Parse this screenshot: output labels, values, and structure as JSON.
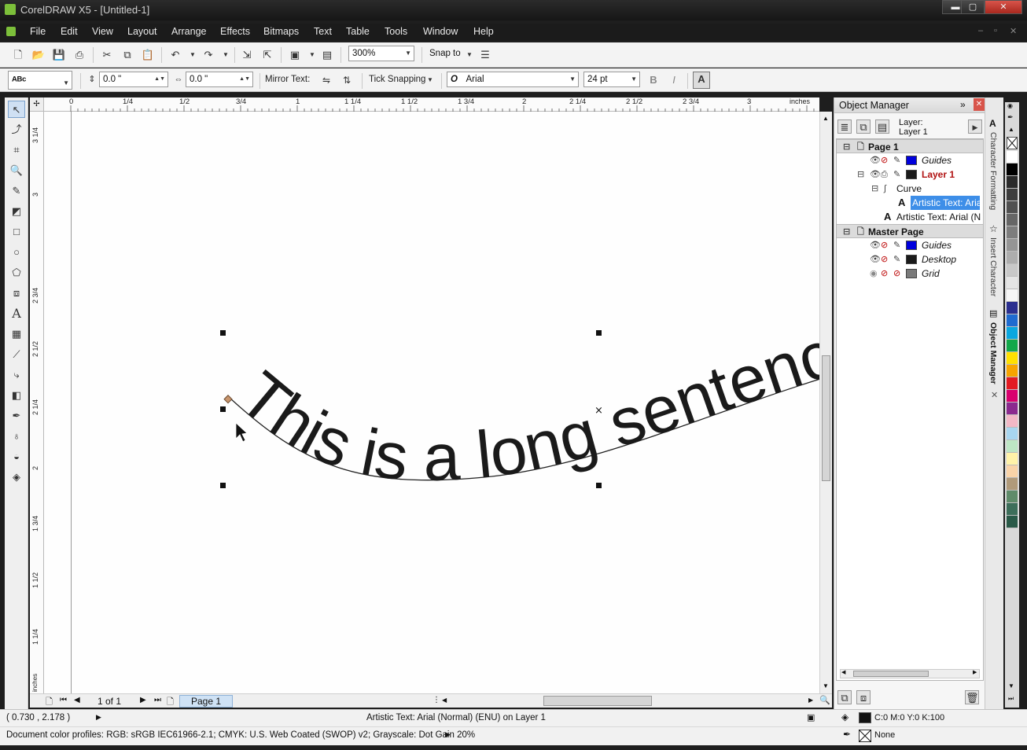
{
  "window": {
    "title": "CorelDRAW X5 - [Untitled-1]",
    "minimize": "▬",
    "maximize": "▢",
    "close": "✕"
  },
  "menu": {
    "items": [
      "File",
      "Edit",
      "View",
      "Layout",
      "Arrange",
      "Effects",
      "Bitmaps",
      "Text",
      "Table",
      "Tools",
      "Window",
      "Help"
    ],
    "mdi_controls": [
      "–",
      "▫",
      "✕"
    ]
  },
  "standard_toolbar": {
    "zoom": "300%",
    "snap_to": "Snap to"
  },
  "property_bar": {
    "preset_label": "ᴬᴮᶜ",
    "offset_x": "0.0 \"",
    "offset_y": "0.0 \"",
    "mirror_text": "Mirror Text:",
    "tick_snapping": "Tick Snapping",
    "font": "Arial",
    "font_glyph": "O",
    "size": "24 pt",
    "bold": "B",
    "italic": "I"
  },
  "ruler": {
    "units": "inches",
    "h_ticks": [
      "0",
      "1/4",
      "1/2",
      "3/4",
      "1",
      "1 1/4",
      "1 1/2",
      "1 3/4",
      "2",
      "2 1/4",
      "2 1/2",
      "2 3/4",
      "3"
    ],
    "v_ticks": [
      "3 1/4",
      "3",
      "2 3/4",
      "2 1/2",
      "2 1/4",
      "2",
      "1 3/4",
      "1 1/2",
      "1 1/4"
    ]
  },
  "canvas": {
    "artistic_text": "This is a long sentence that follows a curve"
  },
  "page_nav": {
    "count": "1 of 1",
    "tab": "Page 1"
  },
  "object_manager": {
    "title": "Object Manager",
    "layer_label": "Layer:",
    "layer_name": "Layer 1",
    "tree": {
      "page1": "Page 1",
      "guides": "Guides",
      "layer1": "Layer 1",
      "curve": "Curve",
      "text_selected": "Artistic Text: Arial",
      "text_other": "Artistic Text: Arial (N",
      "master": "Master Page",
      "master_guides": "Guides",
      "desktop": "Desktop",
      "grid": "Grid"
    },
    "colors": {
      "guides": "#0000dd",
      "layer": "#1a1a1a",
      "desktop": "#1a1a1a",
      "grid": "#7a7a7a",
      "layer_text": "#b01010"
    }
  },
  "side_tabs": [
    "Character Formatting",
    "Insert Character",
    "Object Manager"
  ],
  "palette": [
    "#ffffff",
    "#000000",
    "#2b2b2b",
    "#3d3d3d",
    "#505050",
    "#666666",
    "#7d7d7d",
    "#959595",
    "#adadad",
    "#c8c8c8",
    "#e4e4e4",
    "#f5f5f5",
    "#2b2f8f",
    "#1f6bd0",
    "#0aa7e0",
    "#13a84a",
    "#ffe000",
    "#f7a400",
    "#e31b23",
    "#d8006e",
    "#8b2a8f",
    "#f2b8c6",
    "#a8d6f0",
    "#bde6c4",
    "#fff2a8",
    "#f9d3a8",
    "#b09a7a",
    "#5f8b6a",
    "#3d6e5a",
    "#2a5a48"
  ],
  "status": {
    "coords": "( 0.730 , 2.178 )",
    "info": "Artistic Text: Arial (Normal) (ENU) on Layer 1",
    "fill": "C:0 M:0 Y:0 K:100",
    "outline": "None",
    "profiles": "Document color profiles: RGB: sRGB IEC61966-2.1; CMYK: U.S. Web Coated (SWOP) v2; Grayscale: Dot Gain 20%"
  }
}
